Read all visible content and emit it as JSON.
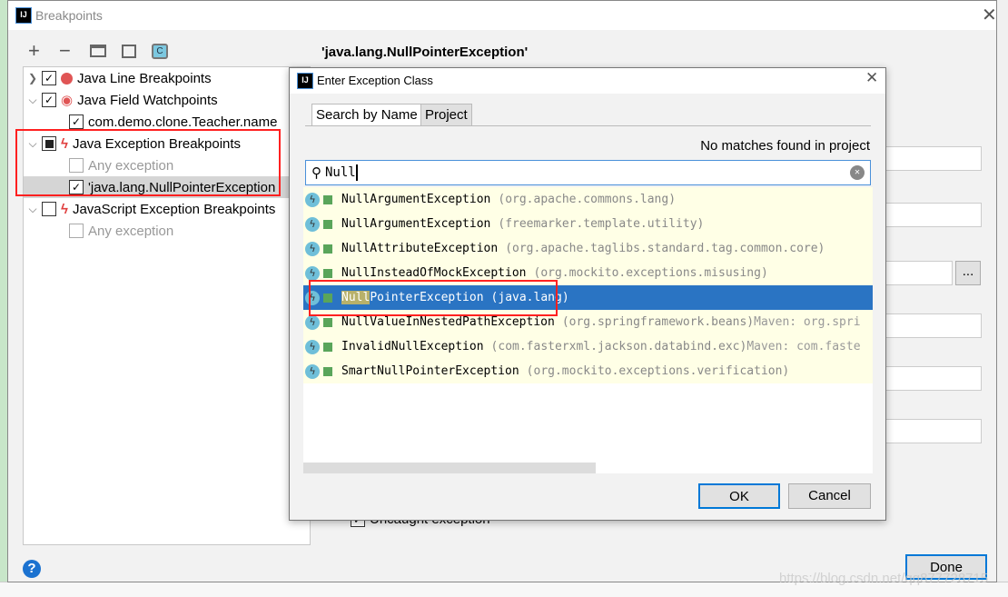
{
  "dialog": {
    "title": "Breakpoints",
    "done_label": "Done",
    "help_label": "?",
    "selected_title": "'java.lang.NullPointerException'",
    "uncaught_label": "Uncaught exception",
    "more_label": "..."
  },
  "toolbar": {
    "add": "+",
    "remove": "−"
  },
  "tree": [
    {
      "label": "Java Line Breakpoints",
      "checked": true,
      "icon": "red-dot-icon"
    },
    {
      "label": "Java Field Watchpoints",
      "checked": true,
      "icon": "eye-icon"
    },
    {
      "label": "com.demo.clone.Teacher.name",
      "checked": true
    },
    {
      "label": "Java Exception Breakpoints",
      "checked": "partial",
      "icon": "lightning-icon"
    },
    {
      "label": "Any exception",
      "checked": false
    },
    {
      "label": "'java.lang.NullPointerException",
      "checked": true
    },
    {
      "label": "JavaScript Exception Breakpoints",
      "checked": false,
      "icon": "lightning-icon"
    },
    {
      "label": "Any exception",
      "checked": false
    }
  ],
  "chooser": {
    "title": "Enter Exception Class",
    "tabs": [
      "Search by Name",
      "Project"
    ],
    "status": "No matches found in project",
    "search_value": "Null",
    "ok_label": "OK",
    "cancel_label": "Cancel",
    "results": [
      {
        "name": "NullArgumentException",
        "pkg": "(org.apache.commons.lang)",
        "maven": ""
      },
      {
        "name": "NullArgumentException",
        "pkg": "(freemarker.template.utility)",
        "maven": ""
      },
      {
        "name": "NullAttributeException",
        "pkg": "(org.apache.taglibs.standard.tag.common.core)",
        "maven": ""
      },
      {
        "name": "NullInsteadOfMockException",
        "pkg": "(org.mockito.exceptions.misusing)",
        "maven": ""
      },
      {
        "name_match": "Null",
        "name_rest": "PointerException",
        "pkg": "(java.lang)",
        "maven": "",
        "selected": true
      },
      {
        "name": "NullValueInNestedPathException",
        "pkg": "(org.springframework.beans)",
        "maven": "Maven: org.spri"
      },
      {
        "name": "InvalidNullException",
        "pkg": "(com.fasterxml.jackson.databind.exc)",
        "maven": "Maven: com.faste"
      },
      {
        "name": "SmartNullPointerException",
        "pkg": "(org.mockito.exceptions.verification)",
        "maven": ""
      }
    ]
  },
  "watermark": "https://blog.csdn.net/qq877728715",
  "colors": {
    "selection": "#2a74c3",
    "highlight_box": "#ff2020",
    "default_button": "#0078d7"
  }
}
